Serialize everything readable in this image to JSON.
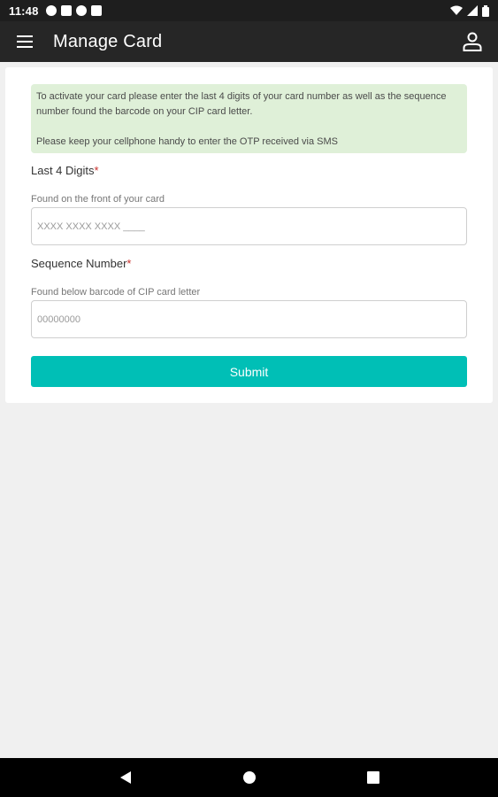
{
  "status_bar": {
    "time": "11:48"
  },
  "app_bar": {
    "title": "Manage Card",
    "menu_icon": "hamburger-menu-icon",
    "profile_icon": "person-icon"
  },
  "info": {
    "line1": "To activate your card please enter the last 4 digits of your card number as well as the sequence number found the barcode on your CIP card letter.",
    "line2": "Please keep your cellphone handy to enter the OTP received via SMS"
  },
  "fields": {
    "last4": {
      "label": "Last 4 Digits",
      "required_mark": "*",
      "hint": "Found on the front of your card",
      "placeholder": "XXXX XXXX XXXX ____",
      "value": ""
    },
    "sequence": {
      "label": "Sequence Number",
      "required_mark": "*",
      "hint": "Found below barcode of CIP card letter",
      "placeholder": "00000000",
      "value": ""
    }
  },
  "submit_label": "Submit",
  "colors": {
    "app_bar": "#262626",
    "accent": "#00bfb6",
    "info_bg": "#dff0d8",
    "required": "#c9302c"
  }
}
